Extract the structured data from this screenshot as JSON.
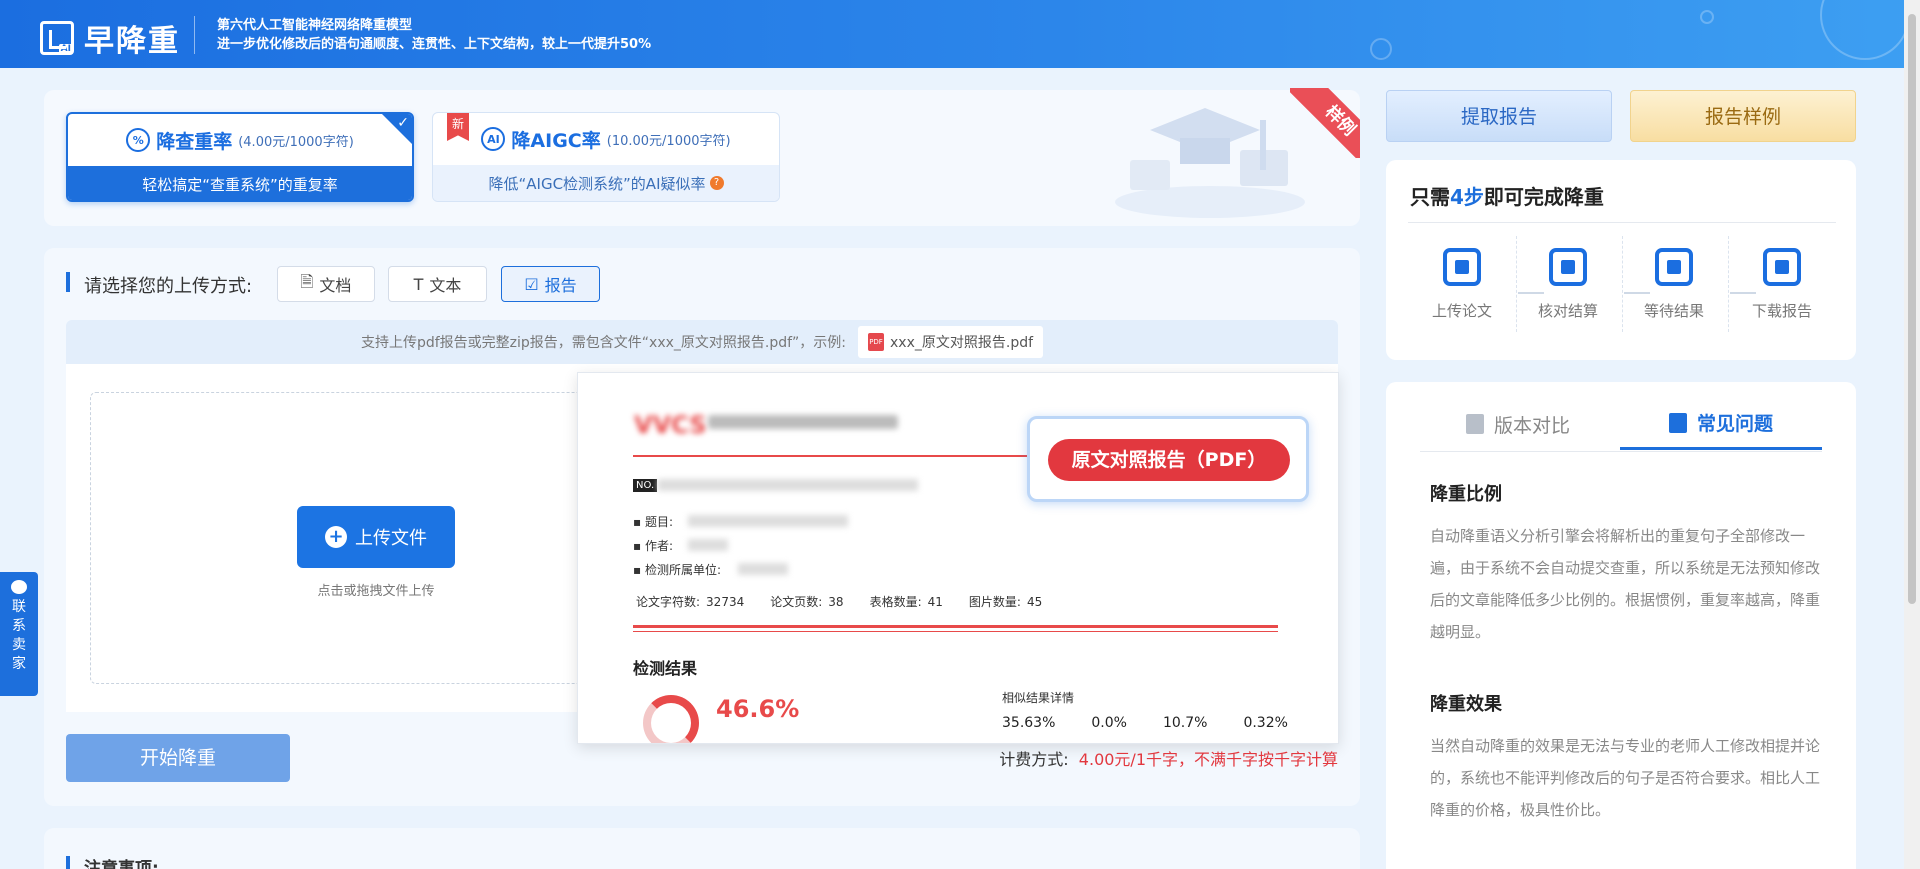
{
  "header": {
    "logo_text": "早降重",
    "logo_badge": "AI",
    "slogan_line1": "第六代人工智能神经网络降重模型",
    "slogan_line2": "进一步优化修改后的语句通顺度、连贯性、上下文结构，较上一代提升50%"
  },
  "modes": [
    {
      "title": "降查重率",
      "price": "(4.00元/1000字符)",
      "desc": "轻松搞定“查重系统”的重复率",
      "active": true
    },
    {
      "title": "降AIGC率",
      "price": "(10.00元/1000字符)",
      "desc": "降低“AIGC检测系统”的AI疑似率",
      "badge": "新",
      "active": false
    }
  ],
  "sample_ribbon": "样例",
  "upload": {
    "label": "请选择您的上传方式:",
    "methods": [
      {
        "label": "文档",
        "icon": "document-icon"
      },
      {
        "label": "文本",
        "icon": "text-icon"
      },
      {
        "label": "报告",
        "icon": "report-icon"
      }
    ],
    "hint": "支持上传pdf报告或完整zip报告，需包含文件“xxx_原文对照报告.pdf”，示例:",
    "sample_file": "xxx_原文对照报告.pdf",
    "upload_button": "上传文件",
    "drop_hint": "点击或拖拽文件上传"
  },
  "preview": {
    "logo": "VVCS",
    "no_label": "NO.",
    "rows": [
      "题目:",
      "作者:",
      "检测所属单位:"
    ],
    "stats": [
      {
        "label": "论文字符数:",
        "value": "32734"
      },
      {
        "label": "论文页数:",
        "value": "38"
      },
      {
        "label": "表格数量:",
        "value": "41"
      },
      {
        "label": "图片数量:",
        "value": "45"
      }
    ],
    "result_title": "检测结果",
    "percent": "46.6%",
    "similar_title": "相似结果详情",
    "similar_values": [
      "35.63%",
      "0.0%",
      "10.7%",
      "0.32%"
    ],
    "callout": "原文对照报告（PDF）"
  },
  "fee": {
    "label": "计费方式:",
    "price": "4.00元/1千字，不满千字按千字计算"
  },
  "start_button": "开始降重",
  "notice": "注意事项:",
  "contact": [
    "联",
    "系",
    "卖",
    "家"
  ],
  "right": {
    "btn_report": "提取报告",
    "btn_sample": "报告样例",
    "steps_pre": "只需",
    "steps_num": "4步",
    "steps_post": "即可完成降重",
    "steps": [
      "上传论文",
      "核对结算",
      "等待结果",
      "下载报告"
    ],
    "tabs": [
      {
        "label": "版本对比"
      },
      {
        "label": "常见问题"
      }
    ],
    "faq": [
      {
        "q": "降重比例",
        "a": "自动降重语义分析引擎会将解析出的重复句子全部修改一遍，由于系统不会自动提交查重，所以系统是无法预知修改后的文章能降低多少比例的。根据惯例，重复率越高，降重越明显。"
      },
      {
        "q": "降重效果",
        "a": "当然自动降重的效果是无法与专业的老师人工修改相提并论的，系统也不能评判修改后的句子是否符合要求。相比人工降重的价格，极具性价比。"
      }
    ]
  },
  "colors": {
    "primary": "#1d6fdc",
    "accent_red": "#e2383f",
    "sample_btn": "#fbe7b5"
  }
}
